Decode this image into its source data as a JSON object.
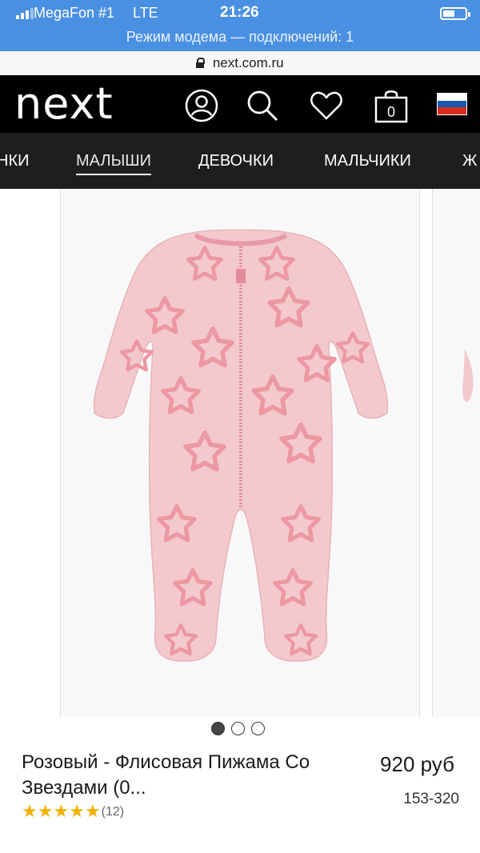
{
  "status": {
    "carrier": "MegaFon #1",
    "network": "LTE",
    "time": "21:26",
    "hotspot": "Режим модема — подключений: 1",
    "battery_level": 0.55
  },
  "browser": {
    "url": "next.com.ru"
  },
  "header": {
    "logo": "next",
    "bag_count": "0",
    "icons": [
      "account-icon",
      "search-icon",
      "heart-icon",
      "bag-icon",
      "russia-flag-icon"
    ]
  },
  "nav": {
    "items": [
      "НКИ",
      "МАЛЫШИ",
      "ДЕВОЧКИ",
      "МАЛЬЧИКИ",
      "Ж"
    ],
    "active_index": 1
  },
  "gallery": {
    "dots": 3,
    "active_dot": 0
  },
  "product": {
    "name": "Розовый - Флисовая Пижама Со Звездами (0...",
    "price": "920 руб",
    "code": "153-320",
    "rating": 5,
    "reviews": "(12)"
  },
  "colors": {
    "pink": "#f3c9cd",
    "star_pink": "#ee9aa4",
    "accent_blue": "#4a90e2",
    "star_gold": "#f2b100"
  }
}
